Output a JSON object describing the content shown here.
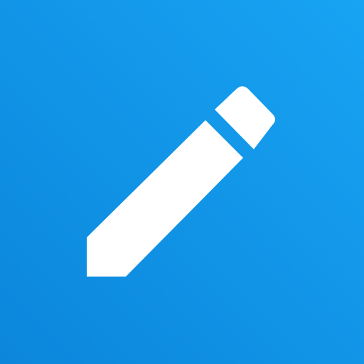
{
  "icon": {
    "name": "pencil-icon",
    "background_color_top_right": "#18a3f3",
    "background_color_bottom_left": "#0b86db",
    "glyph_color": "#ffffff"
  }
}
